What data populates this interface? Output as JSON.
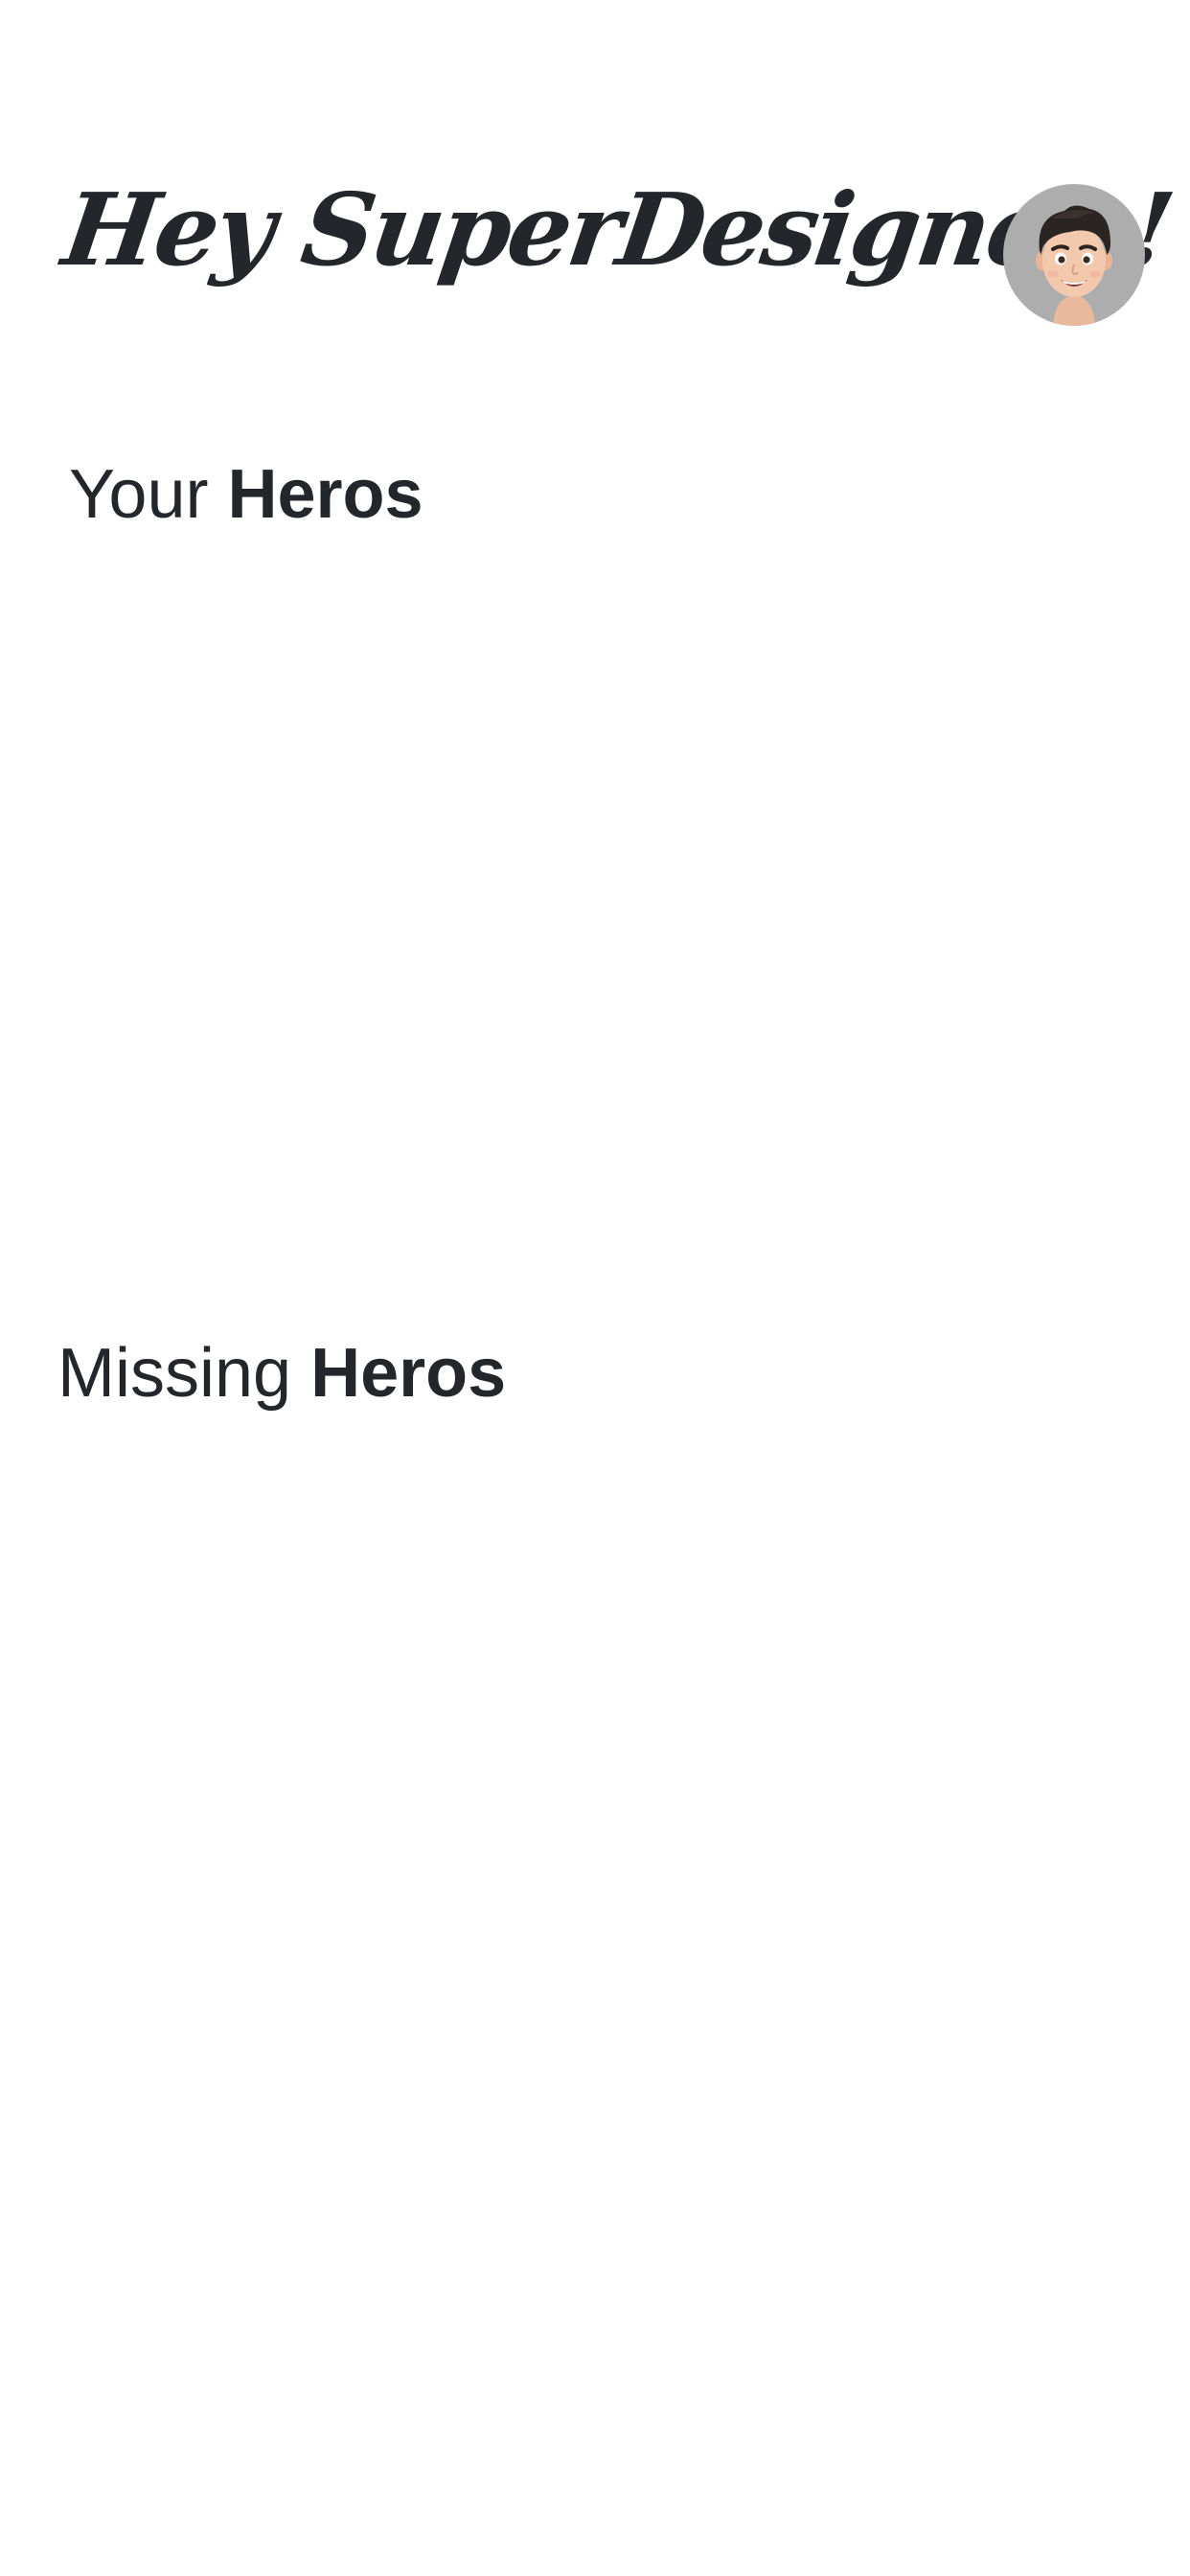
{
  "header": {
    "greeting": "Hey SuperDesigner !",
    "avatar_icon": "memoji-avatar-icon",
    "avatar_bg": "#adadad"
  },
  "sections": {
    "your_heros": {
      "prefix": "Your",
      "emphasis": "Heros"
    },
    "missing_heros": {
      "prefix": "Missing",
      "emphasis": "Heros"
    }
  },
  "colors": {
    "text": "#23272b",
    "background": "#ffffff"
  }
}
